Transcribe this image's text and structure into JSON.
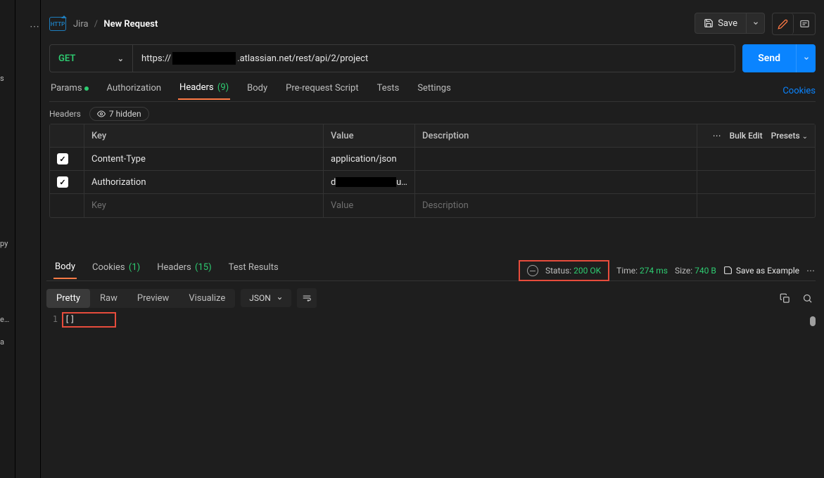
{
  "rail": {
    "r1": "s",
    "r2": "py",
    "r3": "e…",
    "r4": "a"
  },
  "breadcrumb": {
    "collection": "Jira",
    "current": "New Request"
  },
  "save_label": "Save",
  "request": {
    "method": "GET",
    "url_prefix": "https://",
    "url_suffix": ".atlassian.net/rest/api/2/project"
  },
  "send_label": "Send",
  "req_tabs": {
    "params": "Params",
    "authorization": "Authorization",
    "headers": "Headers",
    "headers_count": "(9)",
    "body": "Body",
    "prerequest": "Pre-request Script",
    "tests": "Tests",
    "settings": "Settings",
    "cookies_link": "Cookies"
  },
  "headers_section": {
    "label": "Headers",
    "hidden_count": "7 hidden",
    "col_key": "Key",
    "col_value": "Value",
    "col_desc": "Description",
    "bulk_edit": "Bulk Edit",
    "presets": "Presets",
    "rows": [
      {
        "key": "Content-Type",
        "value": "application/json"
      },
      {
        "key": "Authorization",
        "value_prefix": "d",
        "value_suffix": "u…"
      }
    ],
    "key_placeholder": "Key",
    "value_placeholder": "Value",
    "desc_placeholder": "Description"
  },
  "res_tabs": {
    "body": "Body",
    "cookies": "Cookies",
    "cookies_count": "(1)",
    "headers": "Headers",
    "headers_count": "(15)",
    "test_results": "Test Results"
  },
  "res_meta": {
    "status_label": "Status:",
    "status_value": "200 OK",
    "time_label": "Time:",
    "time_value": "274 ms",
    "size_label": "Size:",
    "size_value": "740 B",
    "save_example": "Save as Example"
  },
  "body_format": {
    "pretty": "Pretty",
    "raw": "Raw",
    "preview": "Preview",
    "visualize": "Visualize",
    "mode": "JSON"
  },
  "response_body": {
    "line1_num": "1",
    "line1_text": "[]"
  }
}
